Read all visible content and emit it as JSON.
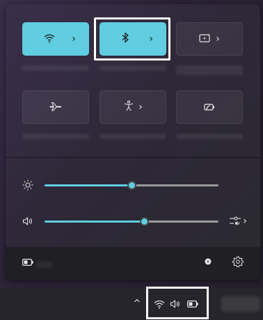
{
  "quick_settings": {
    "tiles_row1": [
      {
        "name": "wifi",
        "icon": "wifi-icon",
        "active": true,
        "expandable": true
      },
      {
        "name": "bluetooth",
        "icon": "bluetooth-icon",
        "active": true,
        "expandable": true
      },
      {
        "name": "nearby-share",
        "icon": "screen-sparkle-icon",
        "active": false,
        "expandable": true
      }
    ],
    "tiles_row2": [
      {
        "name": "airplane-mode",
        "icon": "airplane-icon",
        "active": false,
        "expandable": false
      },
      {
        "name": "accessibility",
        "icon": "accessibility-icon",
        "active": false,
        "expandable": true
      },
      {
        "name": "energy-saver",
        "icon": "battery-saver-icon",
        "active": false,
        "expandable": false
      }
    ],
    "chevron": "›",
    "brightness": {
      "icon": "brightness-icon",
      "level": 0.5
    },
    "volume": {
      "icon": "volume-icon",
      "level": 0.57,
      "output_icon": "audio-output-icon",
      "chevron": "›"
    },
    "footer": {
      "battery_icon": "battery-icon",
      "edit_icon": "edit-icon",
      "settings_icon": "gear-icon"
    }
  },
  "taskbar": {
    "overflow_chevron": "^",
    "tray_icons": [
      "wifi-icon",
      "volume-icon",
      "battery-icon"
    ]
  },
  "colors": {
    "accent": "#60cde0",
    "panel": "#2d2833",
    "footer": "#202024",
    "taskbar": "#26252b"
  }
}
